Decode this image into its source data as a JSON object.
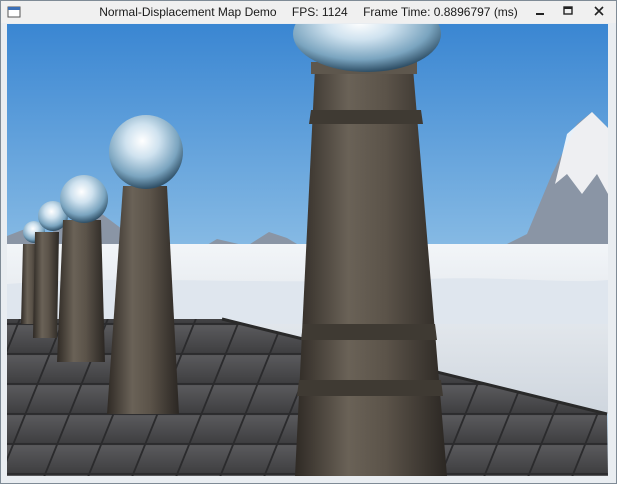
{
  "window": {
    "title": "Normal-Displacement Map Demo",
    "fps_label": "FPS: 1124",
    "frame_time_label": "Frame Time: 0.8896797 (ms)"
  },
  "controls": {
    "minimize_icon": "minimize-icon",
    "maximize_icon": "maximize-icon",
    "close_icon": "close-icon"
  },
  "scene": {
    "sky_color": "#6fa6d8",
    "floor_color": "#4a4a4c",
    "snow_color": "#e6ecf2"
  }
}
